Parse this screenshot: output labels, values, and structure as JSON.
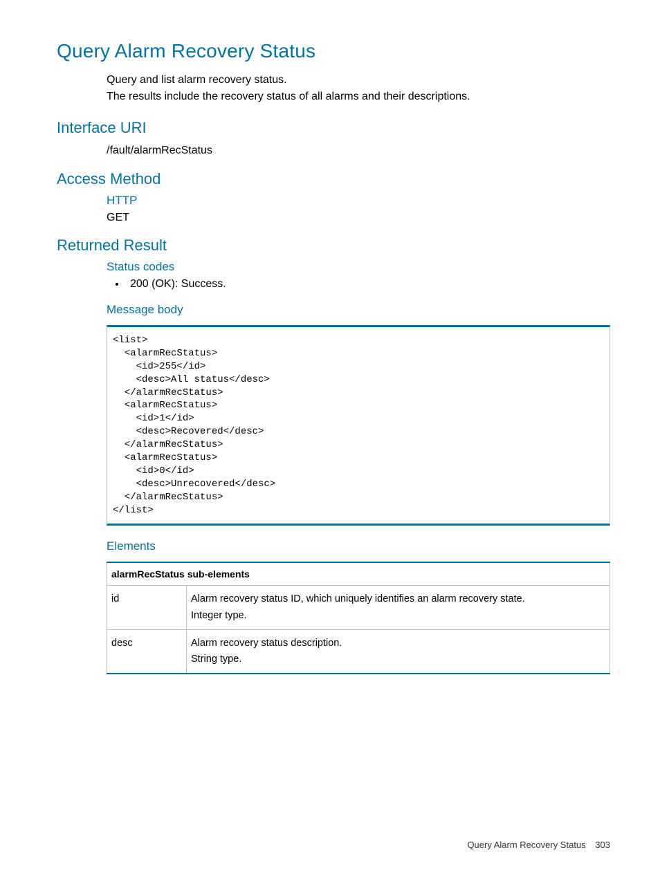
{
  "title": "Query Alarm Recovery Status",
  "intro": {
    "line1": "Query and list alarm recovery status.",
    "line2": "The results include the recovery status of all alarms and their descriptions."
  },
  "sections": {
    "interface_uri": {
      "heading": "Interface URI",
      "value": "/fault/alarmRecStatus"
    },
    "access_method": {
      "heading": "Access Method",
      "sub": "HTTP",
      "value": "GET"
    },
    "returned_result": {
      "heading": "Returned Result",
      "status_codes": {
        "heading": "Status codes",
        "items": [
          "200 (OK): Success."
        ]
      },
      "message_body": {
        "heading": "Message body",
        "code": "<list>\n  <alarmRecStatus>\n    <id>255</id>\n    <desc>All status</desc>\n  </alarmRecStatus>\n  <alarmRecStatus>\n    <id>1</id>\n    <desc>Recovered</desc>\n  </alarmRecStatus>\n  <alarmRecStatus>\n    <id>0</id>\n    <desc>Unrecovered</desc>\n  </alarmRecStatus>\n</list>"
      },
      "elements": {
        "heading": "Elements",
        "table_header": "alarmRecStatus sub-elements",
        "rows": [
          {
            "name": "id",
            "desc": "Alarm recovery status ID, which uniquely identifies an alarm recovery state.\nInteger type."
          },
          {
            "name": "desc",
            "desc": "Alarm recovery status description.\nString type."
          }
        ]
      }
    }
  },
  "footer": {
    "text": "Query Alarm Recovery Status",
    "page": "303"
  }
}
